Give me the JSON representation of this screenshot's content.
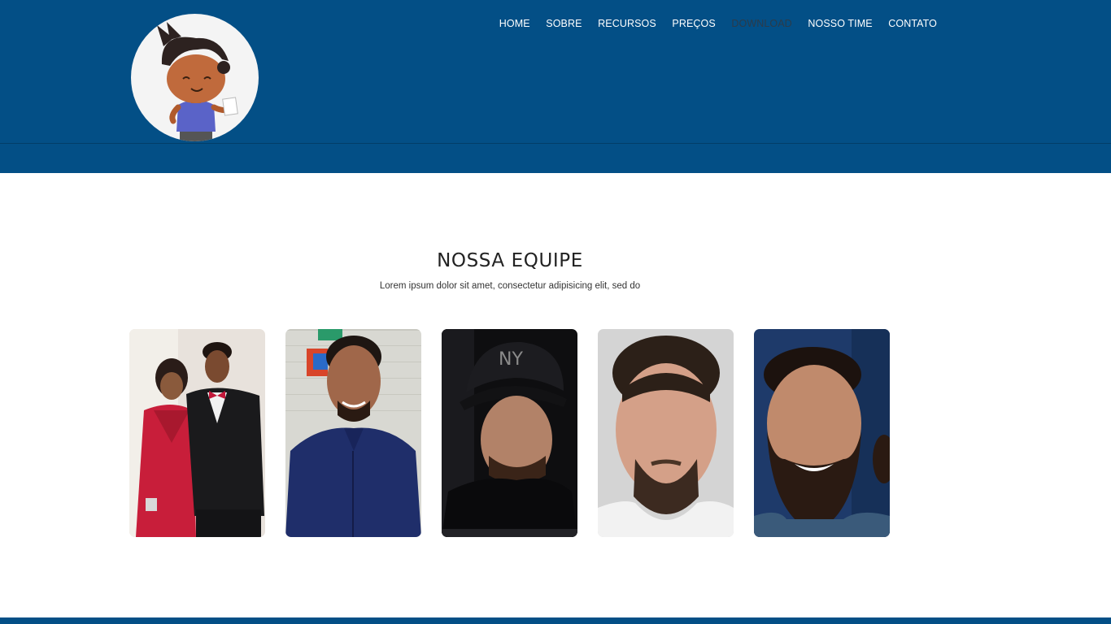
{
  "nav": {
    "items": [
      "HOME",
      "SOBRE",
      "RECURSOS",
      "PREÇOS",
      "DOWNLOAD",
      "NOSSO TIME",
      "CONTATO"
    ],
    "active_index": 4
  },
  "team": {
    "title": "NOSSA EQUIPE",
    "subtitle": "Lorem ipsum dolor sit amet, consectetur adipisicing elit, sed do"
  },
  "colors": {
    "header": "#034f86",
    "active_nav": "#2b3b4a",
    "text": "#222222"
  },
  "icons": {
    "logo": "mascot-boy-icon"
  }
}
